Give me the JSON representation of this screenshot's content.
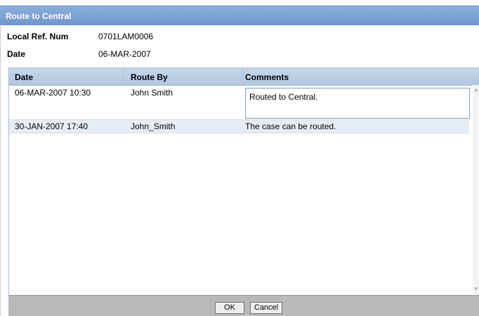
{
  "dialog": {
    "title": "Route to Central"
  },
  "fields": {
    "local_ref_label": "Local Ref. Num",
    "local_ref_value": "0701LAM0006",
    "date_label": "Date",
    "date_value": "06-MAR-2007"
  },
  "grid": {
    "columns": [
      "Date",
      "Route By",
      "Comments"
    ],
    "rows": [
      {
        "date": "06-MAR-2007 10:30",
        "route_by": "John Smith",
        "comments": "Routed to Central."
      },
      {
        "date": "30-JAN-2007 17:40",
        "route_by": "John_Smith",
        "comments": "The case can be routed."
      }
    ]
  },
  "buttons": {
    "ok": "OK",
    "cancel": "Cancel"
  },
  "colors": {
    "titlebar": "#7aa0cf",
    "header": "#bccfe5",
    "selected_row": "#e6edf6",
    "footer": "#b9b9b9"
  }
}
